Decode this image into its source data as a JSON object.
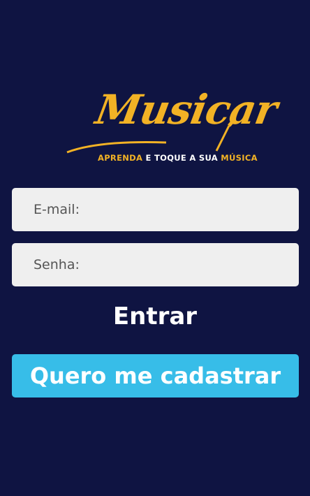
{
  "logo": {
    "brand": "Musicar",
    "tagline_part1": "APRENDA",
    "tagline_part2": "E TOQUE A SUA",
    "tagline_part3": "MÚSICA",
    "icon": "guitar-jack-icon"
  },
  "form": {
    "email_placeholder": "E-mail:",
    "password_placeholder": "Senha:",
    "login_label": "Entrar",
    "register_label": "Quero me cadastrar"
  },
  "colors": {
    "background": "#0f1442",
    "brand_yellow": "#f2b225",
    "input_bg": "#efefef",
    "register_button": "#37bde8"
  }
}
